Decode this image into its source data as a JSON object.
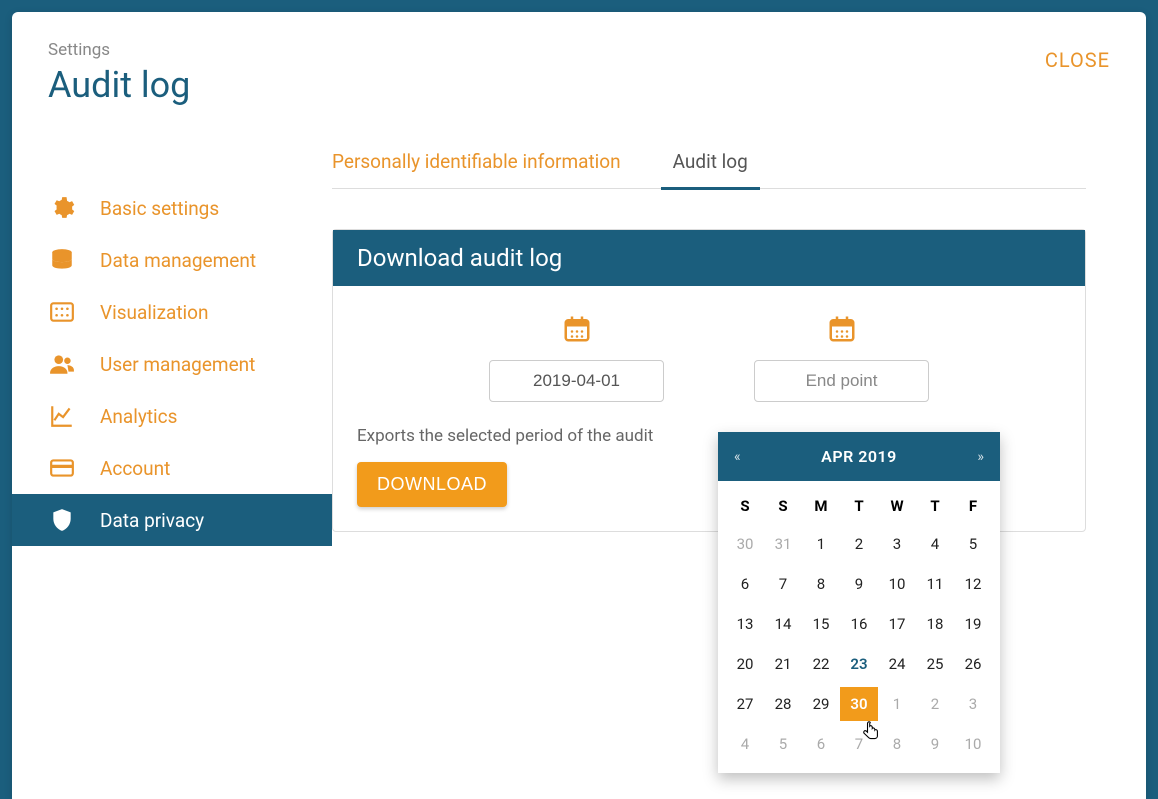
{
  "header": {
    "breadcrumb": "Settings",
    "title": "Audit log",
    "close": "CLOSE"
  },
  "sidebar": {
    "items": [
      {
        "label": "Basic settings",
        "icon": "gear-icon"
      },
      {
        "label": "Data management",
        "icon": "database-icon"
      },
      {
        "label": "Visualization",
        "icon": "grid-icon"
      },
      {
        "label": "User management",
        "icon": "users-icon"
      },
      {
        "label": "Analytics",
        "icon": "chart-icon"
      },
      {
        "label": "Account",
        "icon": "card-icon"
      },
      {
        "label": "Data privacy",
        "icon": "shield-icon",
        "active": true
      }
    ]
  },
  "tabs": [
    {
      "label": "Personally identifiable information",
      "active": false
    },
    {
      "label": "Audit log",
      "active": true
    }
  ],
  "card": {
    "title": "Download audit log",
    "start_value": "2019-04-01",
    "end_placeholder": "End point",
    "description": "Exports the selected period of the audit",
    "download": "DOWNLOAD"
  },
  "datepicker": {
    "title": "APR 2019",
    "prev": "«",
    "next": "»",
    "dow": [
      "S",
      "S",
      "M",
      "T",
      "W",
      "T",
      "F"
    ],
    "weeks": [
      [
        {
          "d": "30",
          "muted": true
        },
        {
          "d": "31",
          "muted": true
        },
        {
          "d": "1"
        },
        {
          "d": "2"
        },
        {
          "d": "3"
        },
        {
          "d": "4"
        },
        {
          "d": "5"
        }
      ],
      [
        {
          "d": "6"
        },
        {
          "d": "7"
        },
        {
          "d": "8"
        },
        {
          "d": "9"
        },
        {
          "d": "10"
        },
        {
          "d": "11"
        },
        {
          "d": "12"
        }
      ],
      [
        {
          "d": "13"
        },
        {
          "d": "14"
        },
        {
          "d": "15"
        },
        {
          "d": "16"
        },
        {
          "d": "17"
        },
        {
          "d": "18"
        },
        {
          "d": "19"
        }
      ],
      [
        {
          "d": "20"
        },
        {
          "d": "21"
        },
        {
          "d": "22"
        },
        {
          "d": "23",
          "today": true
        },
        {
          "d": "24"
        },
        {
          "d": "25"
        },
        {
          "d": "26"
        }
      ],
      [
        {
          "d": "27"
        },
        {
          "d": "28"
        },
        {
          "d": "29"
        },
        {
          "d": "30",
          "selected": true
        },
        {
          "d": "1",
          "muted": true
        },
        {
          "d": "2",
          "muted": true
        },
        {
          "d": "3",
          "muted": true
        }
      ],
      [
        {
          "d": "4",
          "muted": true
        },
        {
          "d": "5",
          "muted": true
        },
        {
          "d": "6",
          "muted": true
        },
        {
          "d": "7",
          "muted": true
        },
        {
          "d": "8",
          "muted": true
        },
        {
          "d": "9",
          "muted": true
        },
        {
          "d": "10",
          "muted": true
        }
      ]
    ]
  }
}
